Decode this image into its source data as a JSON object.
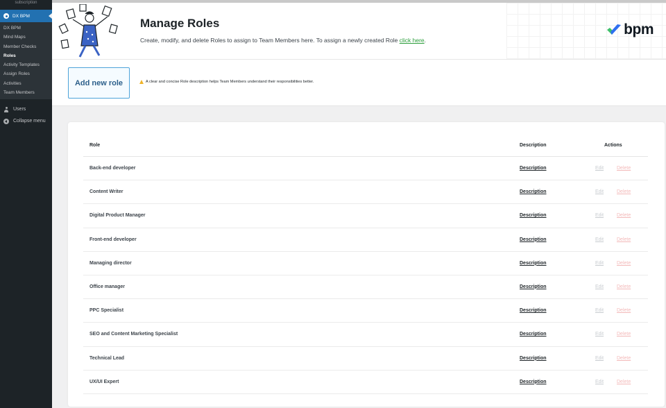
{
  "sidebar": {
    "top_cut_label": "subscription",
    "current_menu": "DX BPM",
    "submenu": [
      "DX BPM",
      "Mind Maps",
      "Member Checks",
      "Roles",
      "Activity Templates",
      "Assign Roles",
      "Activities",
      "Team Members"
    ],
    "active_submenu": "Roles",
    "users_label": "Users",
    "collapse_label": "Collapse menu"
  },
  "header": {
    "title": "Manage Roles",
    "subtitle": "Create, modify, and delete Roles to assign to Team Members here. To assign a newly created Role",
    "subtitle_link": "click here",
    "subtitle_end": ".",
    "logo_text": "bpm",
    "logo_color": "#2f6ff0",
    "logo_check_color": "#3ec06b"
  },
  "toolbar": {
    "add_button": "Add new role",
    "hint": "A clear and concise Role description helps Team Members understand their responsibilities better."
  },
  "table": {
    "headers": {
      "role": "Role",
      "description": "Description",
      "actions": "Actions"
    },
    "rows": [
      {
        "role": "Back-end developer",
        "description": "Description",
        "edit": "Edit",
        "delete": "Delete"
      },
      {
        "role": "Content Writer",
        "description": "Description",
        "edit": "Edit",
        "delete": "Delete"
      },
      {
        "role": "Digital Product Manager",
        "description": "Description",
        "edit": "Edit",
        "delete": "Delete"
      },
      {
        "role": "Front-end developer",
        "description": "Description",
        "edit": "Edit",
        "delete": "Delete"
      },
      {
        "role": "Managing director",
        "description": "Description",
        "edit": "Edit",
        "delete": "Delete"
      },
      {
        "role": "Office manager",
        "description": "Description",
        "edit": "Edit",
        "delete": "Delete"
      },
      {
        "role": "PPC Specialist",
        "description": "Description",
        "edit": "Edit",
        "delete": "Delete"
      },
      {
        "role": "SEO and Content Marketing Specialist",
        "description": "Description",
        "edit": "Edit",
        "delete": "Delete"
      },
      {
        "role": "Technical Lead",
        "description": "Description",
        "edit": "Edit",
        "delete": "Delete"
      },
      {
        "role": "UX/UI Expert",
        "description": "Description",
        "edit": "Edit",
        "delete": "Delete"
      }
    ]
  }
}
